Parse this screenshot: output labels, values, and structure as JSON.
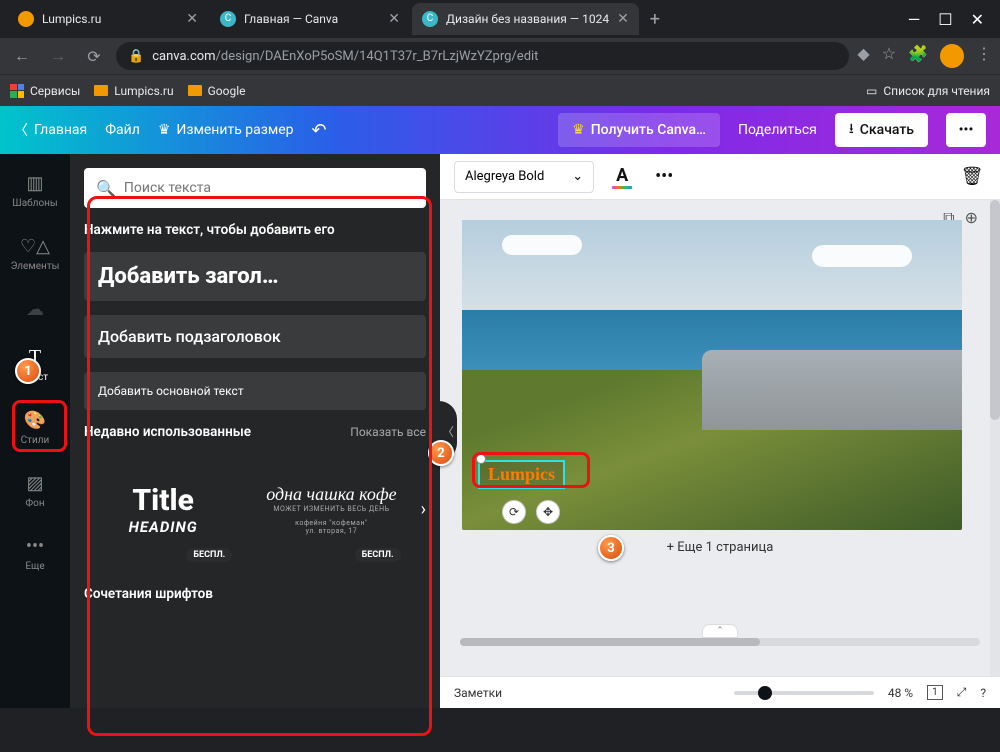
{
  "window": {
    "minimize": "—",
    "maximize": "☐",
    "close": "✕"
  },
  "tabs": [
    {
      "title": "Lumpics.ru",
      "icon_bg": "#f29900"
    },
    {
      "title": "Главная — Canva",
      "icon_bg": "#3db6c8",
      "icon_letter": "C"
    },
    {
      "title": "Дизайн без названия — 1024",
      "icon_bg": "#3db6c8",
      "icon_letter": "C"
    }
  ],
  "tab_close": "✕",
  "newtab": "+",
  "url": {
    "lock": "🔒",
    "domain": "canva.com",
    "path": "/design/DAEnXoP5oSM/14Q1T37r_B7rLzjWzYZprg/edit"
  },
  "bookmarks": {
    "services": "Сервисы",
    "lumpics": "Lumpics.ru",
    "google": "Google",
    "reading": "Список для чтения"
  },
  "canva_header": {
    "home": "Главная",
    "file": "Файл",
    "resize": "Изменить размер",
    "pro": "Получить Canva…",
    "share": "Поделиться",
    "download": "Скачать",
    "more": "•••"
  },
  "sidenav": {
    "templates": "Шаблоны",
    "elements": "Элементы",
    "text": "Текст",
    "styles": "Стили",
    "background": "Фон",
    "more": "Еще"
  },
  "text_panel": {
    "search_placeholder": "Поиск текста",
    "click_hint": "Нажмите на текст, чтобы добавить его",
    "add_heading": "Добавить загол…",
    "add_subheading": "Добавить подзаголовок",
    "add_body": "Добавить основной текст",
    "recent": "Недавно использованные",
    "show_all": "Показать все",
    "tmpl_title": "Title",
    "tmpl_heading": "HEADING",
    "tmpl_coffee": "одна чашка кофе",
    "tmpl_small1": "МОЖЕТ ИЗМЕНИТЬ ВЕСЬ ДЕНЬ",
    "tmpl_small2": "кофейня \"кофеман\"",
    "tmpl_small3": "ул. вторая, 17",
    "badge": "БЕСПЛ.",
    "combos": "Сочетания шрифтов"
  },
  "toolbar": {
    "font": "Alegreya Bold",
    "text_color": "A",
    "more": "•••",
    "trash": "🗑"
  },
  "canvas": {
    "text": "Lumpics",
    "more_pages": "+ Еще 1 страница"
  },
  "footer": {
    "notes": "Заметки",
    "zoom": "48 %"
  },
  "badges": {
    "n1": "1",
    "n2": "2",
    "n3": "3"
  }
}
